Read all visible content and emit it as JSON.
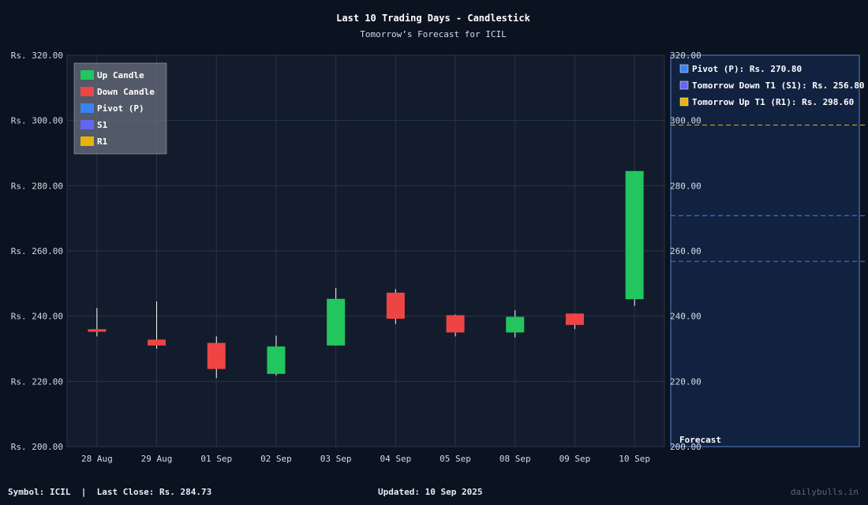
{
  "chart_data": {
    "type": "candlestick",
    "title": "Last 10 Trading Days - Candlestick",
    "subtitle": "Tomorrow’s Forecast for ICIL",
    "categories": [
      "28 Aug",
      "29 Aug",
      "01 Sep",
      "02 Sep",
      "03 Sep",
      "04 Sep",
      "05 Sep",
      "08 Sep",
      "09 Sep",
      "10 Sep"
    ],
    "candles": [
      {
        "open": 236.0,
        "close": 235.2,
        "high": 242.5,
        "low": 233.8
      },
      {
        "open": 232.8,
        "close": 231.0,
        "high": 244.5,
        "low": 230.0
      },
      {
        "open": 231.8,
        "close": 223.8,
        "high": 233.8,
        "low": 221.0
      },
      {
        "open": 222.3,
        "close": 230.7,
        "high": 234.0,
        "low": 221.8
      },
      {
        "open": 231.0,
        "close": 245.3,
        "high": 248.6,
        "low": 231.0
      },
      {
        "open": 247.2,
        "close": 239.2,
        "high": 248.3,
        "low": 237.6
      },
      {
        "open": 240.3,
        "close": 235.0,
        "high": 240.5,
        "low": 233.8
      },
      {
        "open": 235.0,
        "close": 239.8,
        "high": 241.8,
        "low": 233.5
      },
      {
        "open": 240.8,
        "close": 237.3,
        "high": 240.8,
        "low": 236.0
      },
      {
        "open": 245.2,
        "close": 284.5,
        "high": 284.5,
        "low": 243.2
      }
    ],
    "ylim": [
      200,
      320
    ],
    "yticks": [
      "Rs. 200.00",
      "Rs. 220.00",
      "Rs. 240.00",
      "Rs. 260.00",
      "Rs. 280.00",
      "Rs. 300.00",
      "Rs. 320.00"
    ],
    "right_yticks": [
      "200.00",
      "220.00",
      "240.00",
      "260.00",
      "280.00",
      "300.00",
      "320.00"
    ],
    "legend": [
      {
        "label": "Up Candle",
        "color": "#22c55e"
      },
      {
        "label": "Down Candle",
        "color": "#ef4444"
      },
      {
        "label": "Pivot (P)",
        "color": "#3b82f6"
      },
      {
        "label": "S1",
        "color": "#6366f1"
      },
      {
        "label": "R1",
        "color": "#eab308"
      }
    ],
    "legend_position": "top-left",
    "forecast": {
      "label": "Forecast",
      "levels": [
        {
          "label": "Pivot (P): Rs. 270.80",
          "value": 270.8,
          "color": "#3b82f6"
        },
        {
          "label": "Tomorrow Down T1 (S1): Rs. 256.80",
          "value": 256.8,
          "color": "#6366f1"
        },
        {
          "label": "Tomorrow Up T1 (R1): Rs. 298.60",
          "value": 298.6,
          "color": "#eab308"
        }
      ]
    },
    "colors": {
      "up": "#22c55e",
      "down": "#ef4444",
      "grid": "#2a3444"
    }
  },
  "footer": {
    "symbol": "Symbol: ICIL  |  Last Close: Rs. 284.73",
    "updated": "Updated: 10 Sep 2025",
    "brand": "dailybulls.in"
  }
}
